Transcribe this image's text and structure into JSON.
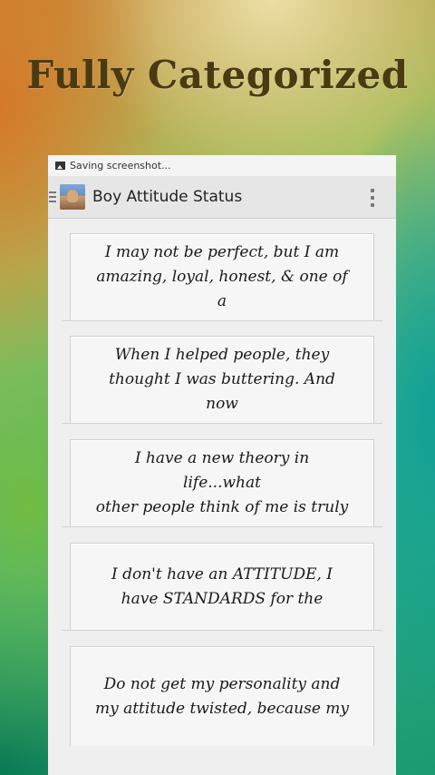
{
  "promo": {
    "title": "Fully Categorized"
  },
  "status_bar": {
    "text": "Saving screenshot..."
  },
  "action_bar": {
    "title": "Boy Attitude Status"
  },
  "icons": [
    "image-icon",
    "drawer-icon",
    "app-icon",
    "overflow-menu-icon"
  ],
  "quotes": [
    {
      "line1": "I may not be perfect, but I am",
      "line2": "amazing, loyal, honest, & one of a"
    },
    {
      "line1": "When I helped people, they",
      "line2": "thought I was buttering. And now"
    },
    {
      "line1": "I have a new theory in life...what",
      "line2": "other people think of me is truly"
    },
    {
      "line1": "I don't have an ATTITUDE, I",
      "line2": "have STANDARDS for the"
    },
    {
      "line1": "Do not get my personality and",
      "line2": "my attitude twisted, because my"
    }
  ]
}
